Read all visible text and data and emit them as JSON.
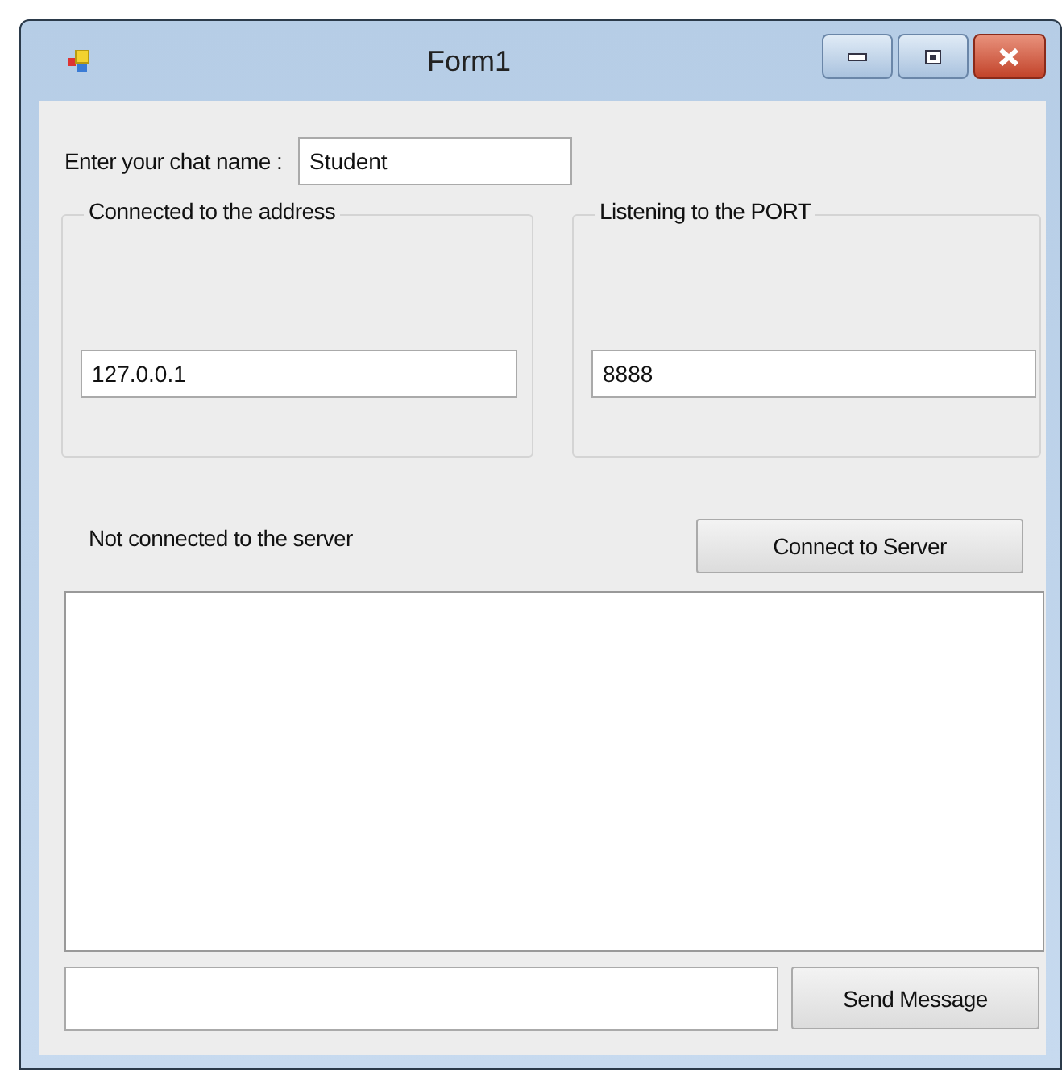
{
  "window": {
    "title": "Form1"
  },
  "chat_name": {
    "label": "Enter your chat name :",
    "value": "Student"
  },
  "groups": [
    {
      "title": "Connected to the address",
      "value": "127.0.0.1"
    },
    {
      "title": "Listening to the PORT",
      "value": "8888"
    }
  ],
  "status": "Not connected to the server",
  "connect_button": "Connect to Server",
  "send_button": "Send Message"
}
